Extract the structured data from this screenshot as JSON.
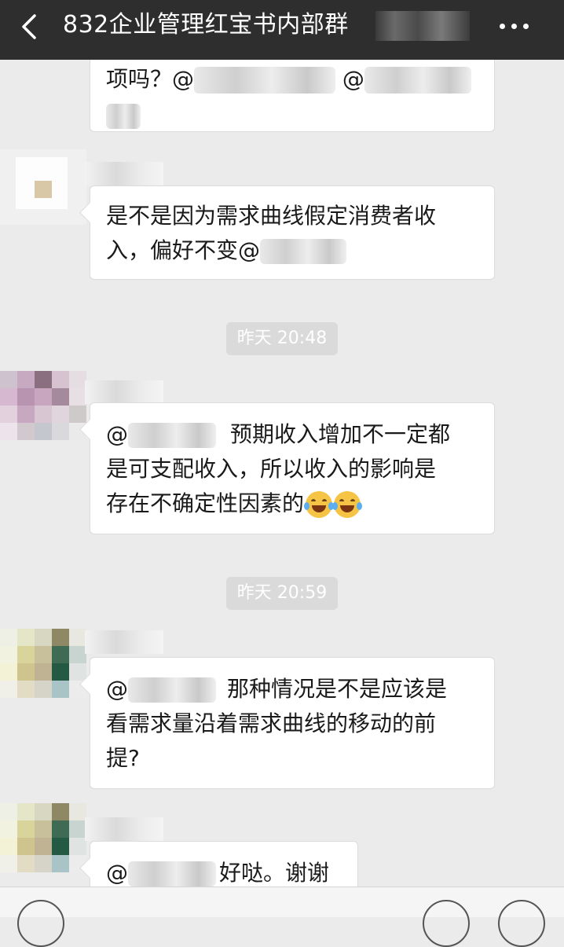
{
  "header": {
    "title": "832企业管理红宝书内部群",
    "back_icon": "chevron-left-icon",
    "more_icon": "more-dots-icon"
  },
  "messages": [
    {
      "line1_prefix": "项吗？@",
      "line1_mid": "@"
    },
    {
      "line1": "是不是因为需求曲线假定消费者收",
      "line2_prefix": "入，偏好不变@"
    },
    {
      "line1_prefix": "@",
      "line1_suffix": "预期收入增加不一定都",
      "line2": "是可支配收入，所以收入的影响是",
      "line3": "存在不确定性因素的"
    },
    {
      "line1_prefix": "@",
      "line1_suffix": "那种情况是不是应该是",
      "line2": "看需求量沿着需求曲线的移动的前",
      "line3": "提?"
    },
    {
      "line1_prefix": "@",
      "line1_suffix": "好哒。谢谢"
    }
  ],
  "timestamps": [
    "昨天 20:48",
    "昨天 20:59"
  ],
  "colors": {
    "header_bg": "#2e2e2e",
    "chat_bg": "#ebebeb",
    "bubble_bg": "#ffffff",
    "timestamp_bg": "#dadada"
  }
}
